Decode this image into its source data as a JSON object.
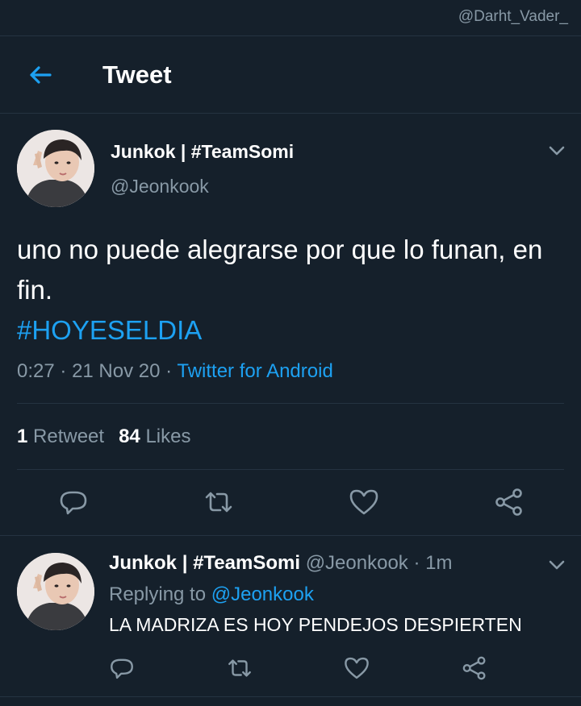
{
  "watermark": "@Darht_Vader_",
  "header": {
    "title": "Tweet"
  },
  "tweet": {
    "display_name": "Junkok | #TeamSomi",
    "handle": "@Jeonkook",
    "text": "uno no puede alegrarse por que lo funan, en fin.",
    "hashtag": "#HOYESELDIA",
    "time": "0:27",
    "dot1": "·",
    "date": "21 Nov 20",
    "dot2": "·",
    "source": "Twitter for Android",
    "retweets_count": "1",
    "retweets_label": "Retweet",
    "likes_count": "84",
    "likes_label": "Likes"
  },
  "reply": {
    "display_name": "Junkok | #TeamSomi",
    "handle": "@Jeonkook",
    "dot": "·",
    "time": "1m",
    "replying_label": "Replying to",
    "replying_to": "@Jeonkook",
    "text": "LA MADRIZA ES HOY PENDEJOS DESPIERTEN"
  },
  "colors": {
    "background": "#15202b",
    "accent": "#1da1f2",
    "secondary_text": "#8899a6",
    "divider": "#253341"
  },
  "icons": {
    "back": "arrow-left-icon",
    "more": "chevron-down-icon",
    "reply": "speech-bubble-icon",
    "retweet": "retweet-icon",
    "like": "heart-icon",
    "share": "share-icon"
  }
}
